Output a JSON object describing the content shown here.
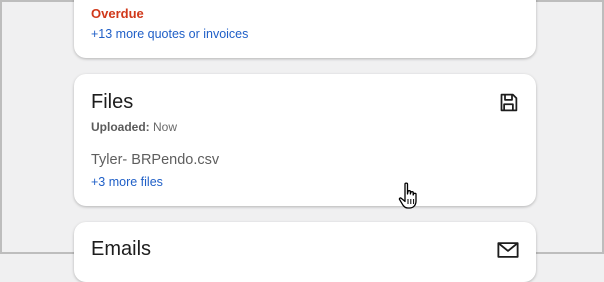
{
  "quotes_card": {
    "status": "Overdue",
    "more_link": "+13 more quotes or invoices"
  },
  "files_card": {
    "title": "Files",
    "uploaded_label": "Uploaded:",
    "uploaded_value": "Now",
    "file_name": "Tyler- BRPendo.csv",
    "more_link": "+3 more files",
    "icon": "save-icon"
  },
  "emails_card": {
    "title": "Emails",
    "icon": "mail-icon"
  },
  "colors": {
    "overdue": "#d0381a",
    "link": "#1f5fc7",
    "background": "#f0f0f1"
  }
}
